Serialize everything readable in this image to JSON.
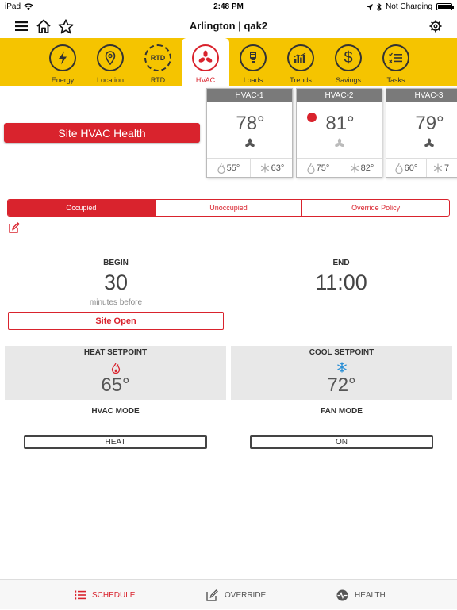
{
  "status_bar": {
    "device": "iPad",
    "time": "2:48 PM",
    "charging": "Not Charging"
  },
  "nav": {
    "title": "Arlington | qak2"
  },
  "tabs": [
    {
      "label": "Energy",
      "icon": "lightning-icon"
    },
    {
      "label": "Location",
      "icon": "location-pin-icon"
    },
    {
      "label": "RTD",
      "icon": "rtd-icon",
      "glyph": "RTD"
    },
    {
      "label": "HVAC",
      "icon": "fan-icon"
    },
    {
      "label": "Loads",
      "icon": "bulb-icon"
    },
    {
      "label": "Trends",
      "icon": "bar-chart-icon"
    },
    {
      "label": "Savings",
      "icon": "dollar-icon",
      "glyph": "$"
    },
    {
      "label": "Tasks",
      "icon": "checklist-icon"
    }
  ],
  "active_tab": "HVAC",
  "site_health_button": "Site HVAC Health",
  "hvac_units": [
    {
      "name": "HVAC-1",
      "temp": "78°",
      "heat": "55°",
      "cool": "63°",
      "alert": false
    },
    {
      "name": "HVAC-2",
      "temp": "81°",
      "heat": "75°",
      "cool": "82°",
      "alert": true
    },
    {
      "name": "HVAC-3",
      "temp": "79°",
      "heat": "60°",
      "cool": "7",
      "alert": false
    }
  ],
  "segments": [
    "Occupied",
    "Unoccupied",
    "Override Policy"
  ],
  "active_segment": "Occupied",
  "schedule": {
    "begin_label": "BEGIN",
    "begin_value": "30",
    "begin_sub": "minutes before",
    "begin_ref": "Site Open",
    "end_label": "END",
    "end_value": "11:00"
  },
  "setpoints": {
    "heat_label": "HEAT SETPOINT",
    "heat_value": "65°",
    "cool_label": "COOL SETPOINT",
    "cool_value": "72°"
  },
  "modes": {
    "hvac_label": "HVAC MODE",
    "hvac_value": "HEAT",
    "fan_label": "FAN MODE",
    "fan_value": "ON"
  },
  "bottom_tabs": [
    "SCHEDULE",
    "OVERRIDE",
    "HEALTH"
  ],
  "colors": {
    "accent": "#d9232d",
    "tabbar": "#f5c400"
  }
}
